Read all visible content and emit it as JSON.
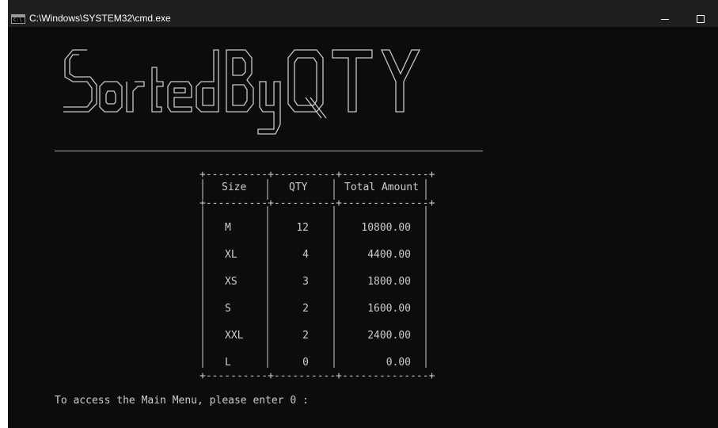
{
  "window": {
    "title": "C:\\Windows\\SYSTEM32\\cmd.exe",
    "icon_label": "C:\\",
    "controls": [
      "minimize-icon",
      "maximize-icon"
    ]
  },
  "banner": {
    "text": "SortedByQTY",
    "lines": [
      "   ____             _           _ ____          ___ _______ __   __",
      "  / ___|  ___  _ __| |_ ___  __| | __ ) _   _  / _ \\_   _\\ \\ / /",
      "  \\___ \\ / _ \\| '__| __/ _ \\/ _` |  _ \\| | | || | | || |  \\ V / ",
      "   ___) | (_) | |  | ||  __/ (_| | |_) | |_| || |_| || |   | |  ",
      "  |____/ \\___/|_|   \\__\\___|\\__,_|____/ \\__, | \\__\\_\\|_|   |_|  ",
      "                                        |___/                    "
    ]
  },
  "table": {
    "border_top": "+----------+----------+--------------+",
    "header": {
      "size": "Size",
      "qty": "QTY",
      "total": "Total Amount"
    },
    "rows": [
      {
        "size": "M",
        "qty": "12",
        "total": "10800.00"
      },
      {
        "size": "XL",
        "qty": "4",
        "total": "4400.00"
      },
      {
        "size": "XS",
        "qty": "3",
        "total": "1800.00"
      },
      {
        "size": "S",
        "qty": "2",
        "total": "1600.00"
      },
      {
        "size": "XXL",
        "qty": "2",
        "total": "2400.00"
      },
      {
        "size": "L",
        "qty": "0",
        "total": "0.00"
      }
    ]
  },
  "prompt": {
    "text": "To access the Main Menu, please enter 0 : "
  },
  "colors": {
    "background": "#0c0c0c",
    "text": "#cccccc",
    "titlebar": "#1f1f1f"
  }
}
